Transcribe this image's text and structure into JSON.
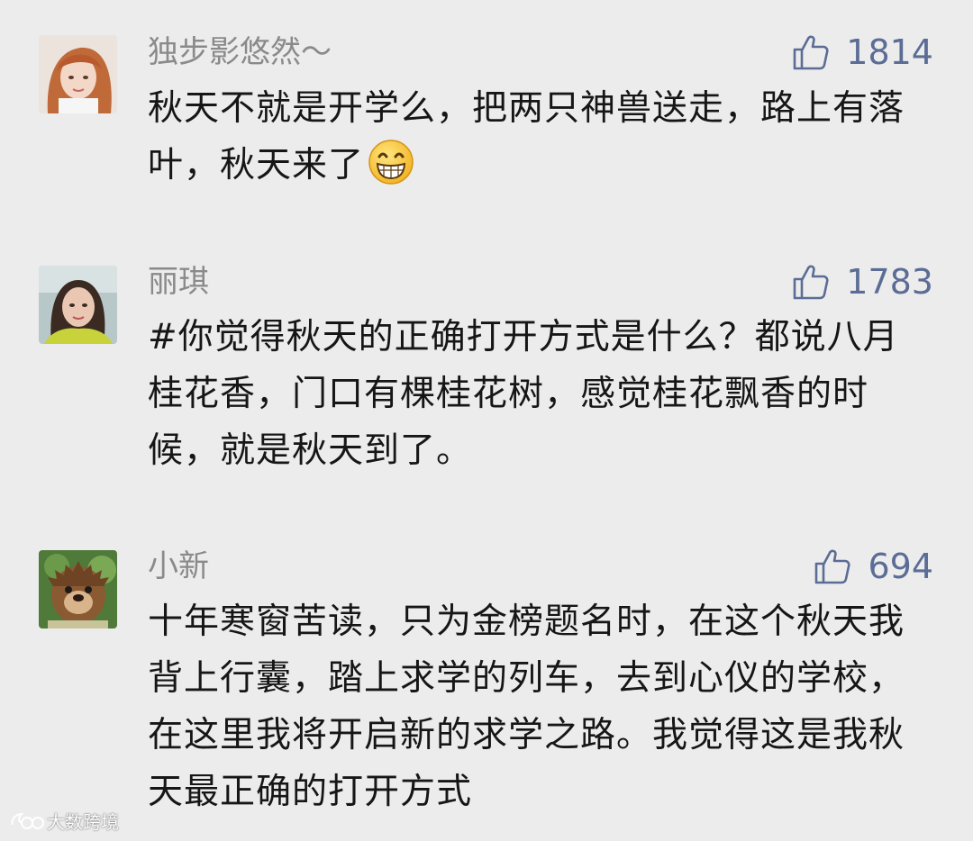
{
  "comments": [
    {
      "username": "独步影悠然～",
      "likes": "1814",
      "text": "秋天不就是开学么，把两只神兽送走，路上有落叶，秋天来了",
      "emoji": "grinning-face-emoji"
    },
    {
      "username": "丽琪",
      "likes": "1783",
      "text": "#你觉得秋天的正确打开方式是什么？都说八月桂花香，门口有棵桂花树，感觉桂花飘香的时候，就是秋天到了。"
    },
    {
      "username": "小新",
      "likes": "694",
      "text": "十年寒窗苦读，只为金榜题名时，在这个秋天我背上行囊，踏上求学的列车，去到心仪的学校，在这里我将开启新的求学之路。我觉得这是我秋天最正确的打开方式"
    }
  ],
  "watermark": {
    "text": "大数跨境",
    "icon": "weibo-logo-icon"
  },
  "colors": {
    "background": "#ececec",
    "username": "#8a8a8a",
    "like": "#5b6c95",
    "text": "#161616"
  }
}
